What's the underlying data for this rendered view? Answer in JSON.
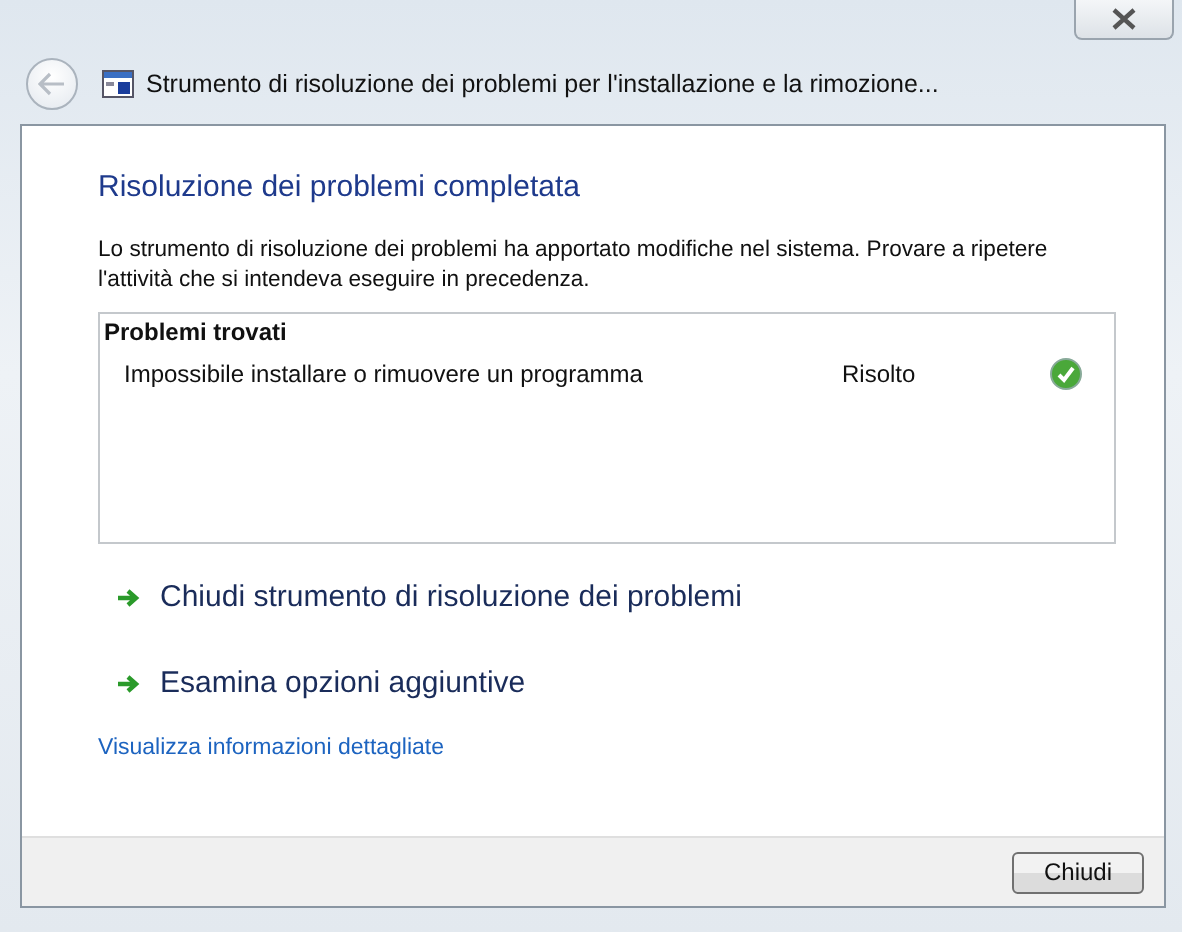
{
  "window": {
    "title": "Strumento di risoluzione dei problemi per l'installazione e la rimozione...",
    "back_disabled": true
  },
  "heading": "Risoluzione dei problemi completata",
  "description": "Lo strumento di risoluzione dei problemi ha apportato modifiche nel sistema. Provare a ripetere l'attività che si intendeva eseguire in precedenza.",
  "problems": {
    "title": "Problemi trovati",
    "rows": [
      {
        "name": "Impossibile installare o rimuovere un programma",
        "status": "Risolto",
        "kind": "resolved"
      }
    ]
  },
  "actions": [
    {
      "label": "Chiudi strumento di risoluzione dei problemi"
    },
    {
      "label": "Esamina opzioni aggiuntive"
    }
  ],
  "details_link": "Visualizza informazioni dettagliate",
  "buttons": [
    "Chiudi"
  ]
}
